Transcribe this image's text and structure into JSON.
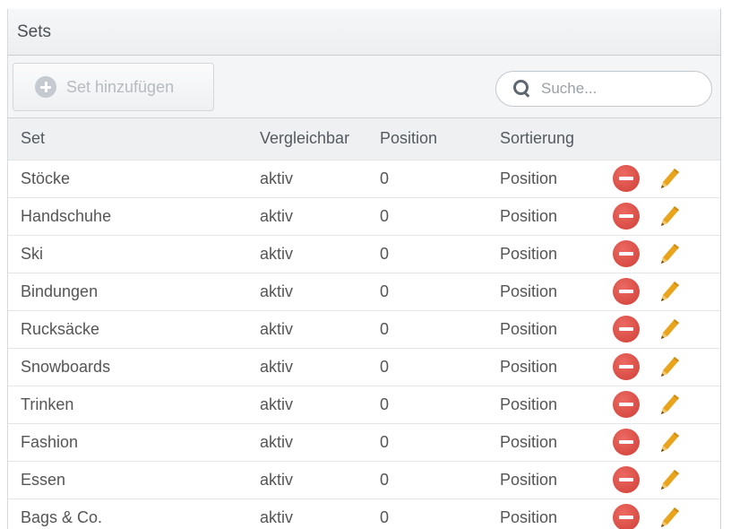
{
  "panel": {
    "title": "Sets"
  },
  "toolbar": {
    "add_label": "Set hinzufügen",
    "add_icon": "plus-circle-icon",
    "search_placeholder": "Suche...",
    "search_value": "",
    "search_icon": "magnifier-icon"
  },
  "table": {
    "columns": [
      "Set",
      "Vergleichbar",
      "Position",
      "Sortierung",
      ""
    ],
    "rows": [
      {
        "set": "Stöcke",
        "vergleichbar": "aktiv",
        "position": "0",
        "sortierung": "Position"
      },
      {
        "set": "Handschuhe",
        "vergleichbar": "aktiv",
        "position": "0",
        "sortierung": "Position"
      },
      {
        "set": "Ski",
        "vergleichbar": "aktiv",
        "position": "0",
        "sortierung": "Position"
      },
      {
        "set": "Bindungen",
        "vergleichbar": "aktiv",
        "position": "0",
        "sortierung": "Position"
      },
      {
        "set": "Rucksäcke",
        "vergleichbar": "aktiv",
        "position": "0",
        "sortierung": "Position"
      },
      {
        "set": "Snowboards",
        "vergleichbar": "aktiv",
        "position": "0",
        "sortierung": "Position"
      },
      {
        "set": "Trinken",
        "vergleichbar": "aktiv",
        "position": "0",
        "sortierung": "Position"
      },
      {
        "set": "Fashion",
        "vergleichbar": "aktiv",
        "position": "0",
        "sortierung": "Position"
      },
      {
        "set": "Essen",
        "vergleichbar": "aktiv",
        "position": "0",
        "sortierung": "Position"
      },
      {
        "set": "Bags & Co.",
        "vergleichbar": "aktiv",
        "position": "0",
        "sortierung": "Position"
      }
    ],
    "row_actions": [
      "delete-icon",
      "edit-icon"
    ]
  },
  "colors": {
    "delete": "#d9463e",
    "edit": "#e9a41c",
    "header_bg": "#eef0f2"
  }
}
